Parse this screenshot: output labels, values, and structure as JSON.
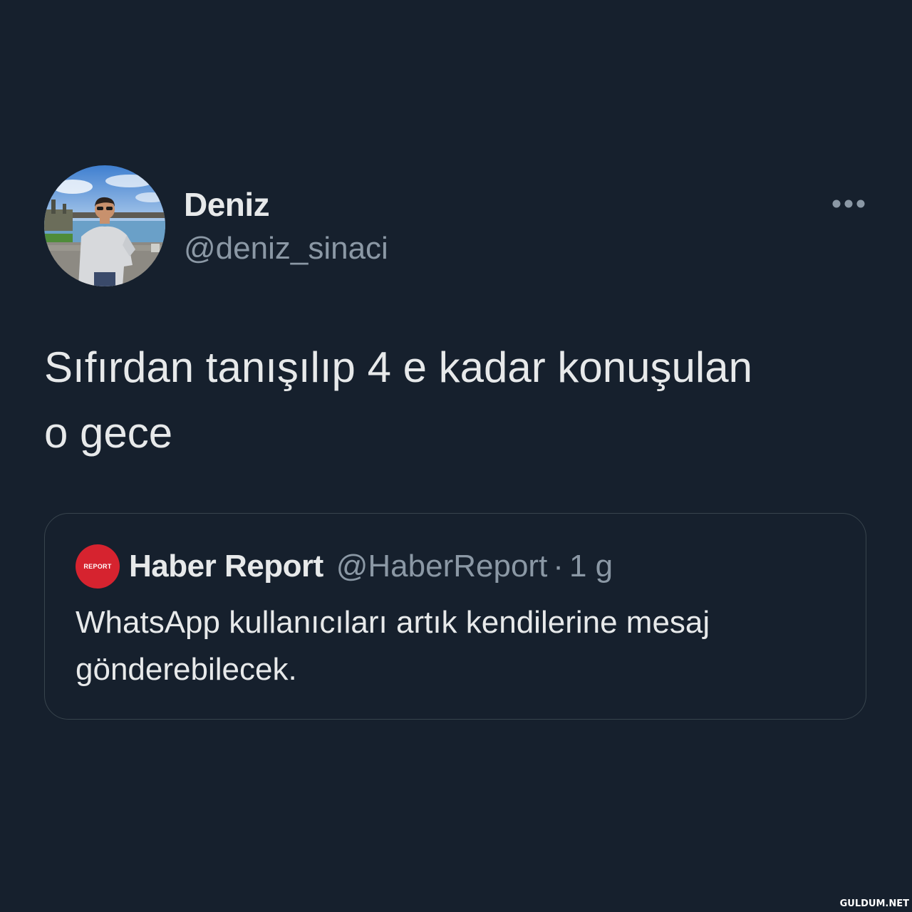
{
  "tweet": {
    "author": {
      "display_name": "Deniz",
      "handle": "@deniz_sinaci"
    },
    "more_icon": "more-horizontal-icon",
    "text": "Sıfırdan tanışılıp 4 e kadar konuşulan\no gece"
  },
  "quote": {
    "avatar_text": "REPORT",
    "display_name": "Haber Report",
    "handle": "@HaberReport",
    "separator": "·",
    "time": "1 g",
    "text": "WhatsApp kullanıcıları artık kendilerine mesaj gönderebilecek."
  },
  "watermark": "GULDUM.NET",
  "colors": {
    "background": "#16202d",
    "primary_text": "#e7e9ea",
    "secondary_text": "#8b98a5",
    "border": "#38444d",
    "quote_avatar": "#d6232f"
  }
}
